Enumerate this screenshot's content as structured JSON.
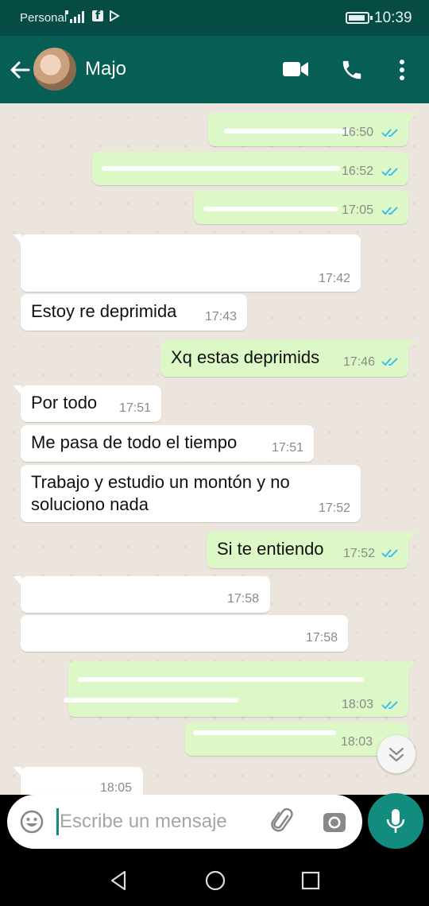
{
  "status_bar": {
    "carrier": "Personal",
    "clock": "10:39"
  },
  "app_bar": {
    "contact_name": "Majo"
  },
  "messages": [
    {
      "dir": "out",
      "text": "",
      "time": "16:50",
      "read": true
    },
    {
      "dir": "out",
      "text": "",
      "time": "16:52",
      "read": true
    },
    {
      "dir": "out",
      "text": "",
      "time": "17:05",
      "read": true
    },
    {
      "dir": "in",
      "text": "",
      "time": "17:42"
    },
    {
      "dir": "in",
      "text": "Estoy re deprimida",
      "time": "17:43"
    },
    {
      "dir": "out",
      "text": "Xq estas deprimids",
      "time": "17:46",
      "read": true
    },
    {
      "dir": "in",
      "text": "Por todo",
      "time": "17:51"
    },
    {
      "dir": "in",
      "text": "Me pasa de todo el tiempo",
      "time": "17:51"
    },
    {
      "dir": "in",
      "text": "Trabajo y estudio un montón y no\nsoluciono nada",
      "time": "17:52"
    },
    {
      "dir": "out",
      "text": "Si te entiendo",
      "time": "17:52",
      "read": true
    },
    {
      "dir": "in",
      "text": "",
      "time": "17:58"
    },
    {
      "dir": "in",
      "text": "",
      "time": "17:58"
    },
    {
      "dir": "out",
      "text": "",
      "time": "18:03",
      "read": true
    },
    {
      "dir": "out",
      "text": "",
      "time": "18:03",
      "read": true
    },
    {
      "dir": "in",
      "text": "",
      "time": "18:05"
    }
  ],
  "composer": {
    "placeholder": "Escribe un mensaje"
  },
  "colors": {
    "header": "#075e54",
    "status_bar": "#054d44",
    "outgoing": "#dcf8c6",
    "incoming": "#ffffff",
    "accent": "#128c7e",
    "read_tick": "#34b7f1"
  },
  "icons": {
    "back": "arrow-left-icon",
    "video": "video-camera-icon",
    "call": "phone-icon",
    "menu": "more-vert-icon",
    "emoji": "emoji-icon",
    "attach": "paperclip-icon",
    "camera": "camera-icon",
    "mic": "microphone-icon",
    "scroll": "double-chevron-down-icon",
    "nav_back": "nav-back-icon",
    "nav_home": "nav-home-icon",
    "nav_recents": "nav-recents-icon"
  }
}
